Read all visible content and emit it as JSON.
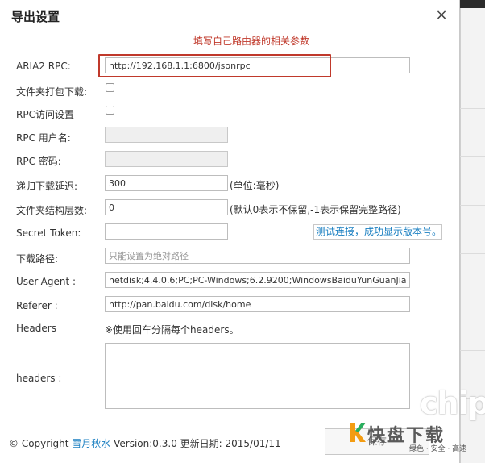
{
  "dialog": {
    "title": "导出设置",
    "close_label": "×",
    "hint": "填写自己路由器的相关参数"
  },
  "fields": {
    "aria2_rpc": {
      "label": "ARIA2 RPC:",
      "value": "http://192.168.1.1:6800/jsonrpc"
    },
    "pack_download": {
      "label": "文件夹打包下载:",
      "checked": false
    },
    "rpc_access": {
      "label": "RPC访问设置",
      "checked": false
    },
    "rpc_user": {
      "label": "RPC 用户名:",
      "value": ""
    },
    "rpc_password": {
      "label": "RPC 密码:",
      "value": ""
    },
    "recursive_delay": {
      "label": "递归下载延迟:",
      "value": "300",
      "note": "(单位:毫秒)"
    },
    "folder_depth": {
      "label": "文件夹结构层数:",
      "value": "0",
      "note": "(默认0表示不保留,-1表示保留完整路径)"
    },
    "secret_token": {
      "label": "Secret Token:",
      "value": "",
      "test_link": "测试连接，成功显示版本号。"
    },
    "download_path": {
      "label": "下载路径:",
      "placeholder": "只能设置为绝对路径"
    },
    "user_agent": {
      "label": "User-Agent :",
      "value": "netdisk;4.4.0.6;PC;PC-Windows;6.2.9200;WindowsBaiduYunGuanJia"
    },
    "referer": {
      "label": "Referer :",
      "value": "http://pan.baidu.com/disk/home"
    },
    "headers": {
      "section_label": "Headers",
      "hint": "※使用回车分隔每个headers。",
      "label": "headers :",
      "value": ""
    }
  },
  "footer": {
    "copyright": "© Copyright",
    "author": "雪月秋水",
    "version": "Version:0.3.0 更新日期: 2015/01/11",
    "save_label": "保存"
  },
  "watermark": {
    "chip": "chip",
    "name": "快盘下载",
    "tagline": "绿色 · 安全 · 高速"
  },
  "colors": {
    "hint": "#c0392b",
    "link": "#1a7fc1",
    "highlight_border": "#c0392b"
  }
}
